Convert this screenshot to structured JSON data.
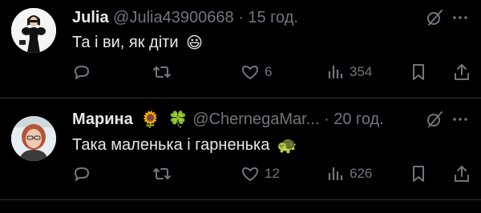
{
  "tweets": [
    {
      "name": "Julia",
      "handle": "@Julia43900668",
      "dot": "·",
      "time": "15 год.",
      "text": "Та і ви, як діти",
      "text_emoji": "😃",
      "stats": {
        "replies": "",
        "retweets": "",
        "likes": "6",
        "views": "354"
      }
    },
    {
      "name": "Марина",
      "handle": "@ChernegaMar...",
      "dot": "·",
      "time": "20 год.",
      "text": "Така маленька і гарненька",
      "text_emoji": "🐢",
      "name_emojis": [
        "🌻",
        "🍀"
      ],
      "stats": {
        "replies": "",
        "retweets": "",
        "likes": "12",
        "views": "626"
      }
    }
  ],
  "colors": {
    "background": "#000000",
    "primary_text": "#e7e9ea",
    "secondary_text": "#71767b",
    "divider": "#2f3336"
  },
  "icons": [
    "reply-icon",
    "retweet-icon",
    "like-icon",
    "views-icon",
    "bookmark-icon",
    "share-icon",
    "grok-icon",
    "more-icon"
  ]
}
